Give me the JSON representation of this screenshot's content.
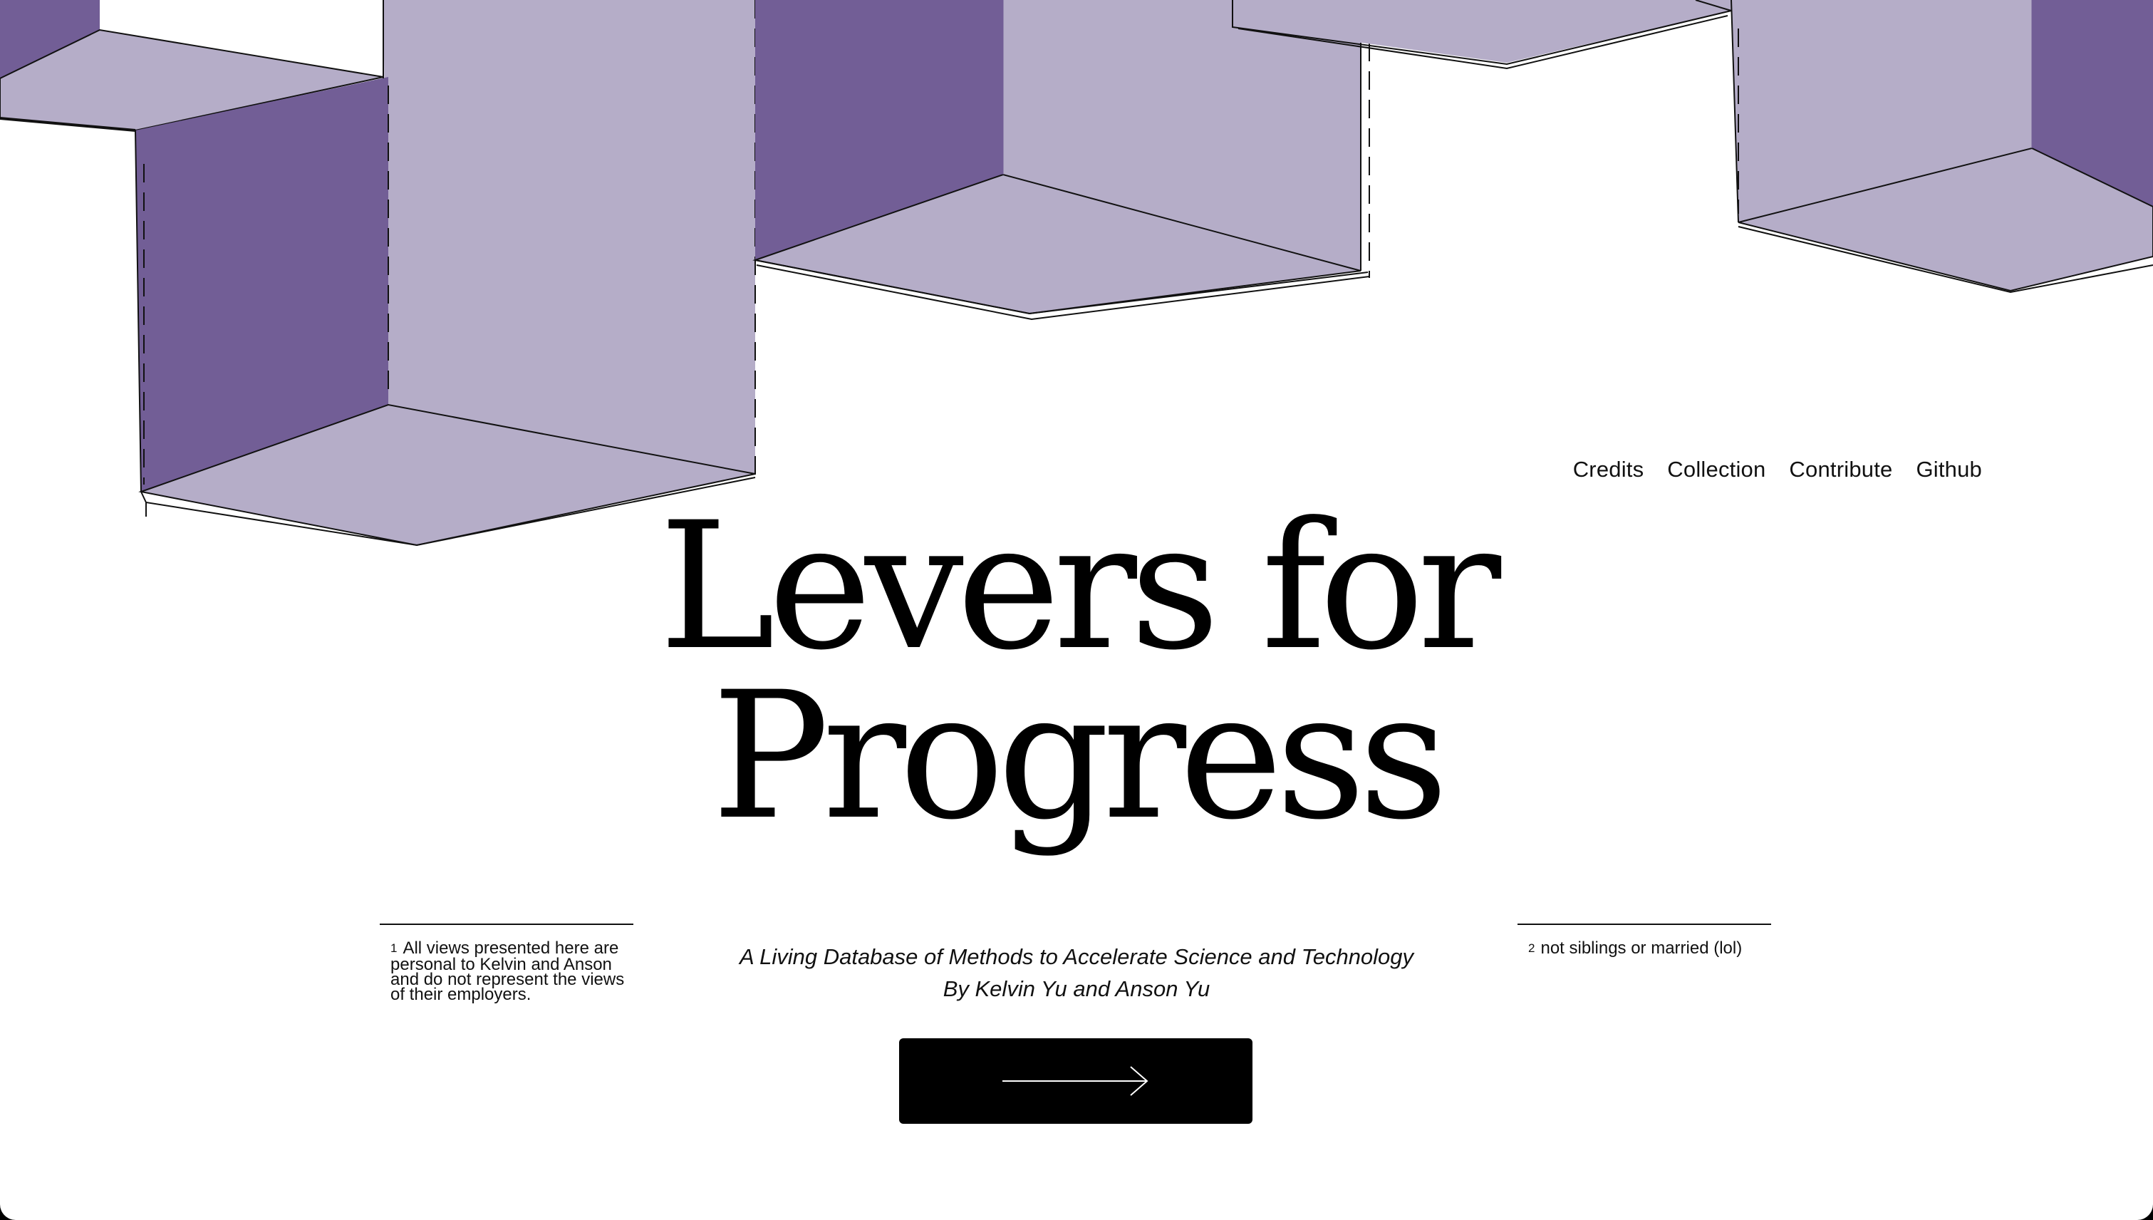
{
  "nav": {
    "items": [
      {
        "label": "Credits"
      },
      {
        "label": "Collection"
      },
      {
        "label": "Contribute"
      },
      {
        "label": "Github"
      }
    ]
  },
  "hero": {
    "title_line1": "Levers for",
    "title_line2": "Progress",
    "subtitle": "A Living Database of Methods to Accelerate Science and Technology",
    "byline": "By Kelvin Yu and Anson Yu"
  },
  "footnotes": [
    {
      "number": "1",
      "text": "All views presented here are personal to Kelvin and Anson and do not represent the views of their employers."
    },
    {
      "number": "2",
      "text": "not siblings or married (lol)"
    }
  ],
  "cta": {
    "icon": "arrow-right-icon"
  },
  "colors": {
    "light_purple": "#b5adc8",
    "dark_purple": "#725e96",
    "background": "#ffffff",
    "ink": "#000000"
  }
}
